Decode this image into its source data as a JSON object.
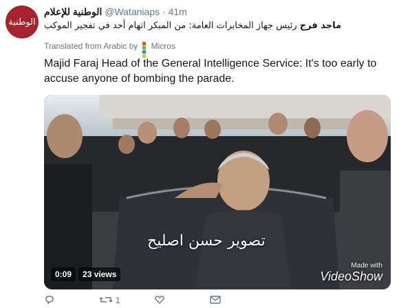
{
  "tweet": {
    "avatar_text": "الوطنية",
    "display_name": "الوطنية للإعلام",
    "handle": "@Wataniaps",
    "separator": "·",
    "time": "41m",
    "arabic_lead": "ماجد فرج",
    "arabic_rest": " رئيس جهاز المخابرات العامة: من المبكر اتهام أحد في تفجير الموكب",
    "translated_label": "Translated from Arabic by",
    "translator": "Micros",
    "english_text": "Majid Faraj Head of the General Intelligence Service: It's too early to accuse anyone of bombing the parade."
  },
  "video": {
    "watermark": "تصوير حسن اصليح",
    "made_with": "Made with",
    "brand": "VideoShow",
    "duration": "0:09",
    "views": "23 views"
  },
  "actions": {
    "retweets": "1"
  },
  "colors": {
    "avatar_bg": "#a6232e",
    "ms_logo": [
      "#f25022",
      "#7fba00",
      "#00a4ef",
      "#ffb900"
    ]
  },
  "icons": [
    "reply-icon",
    "retweet-icon",
    "like-icon",
    "dm-icon",
    "microsoft-logo-icon"
  ]
}
